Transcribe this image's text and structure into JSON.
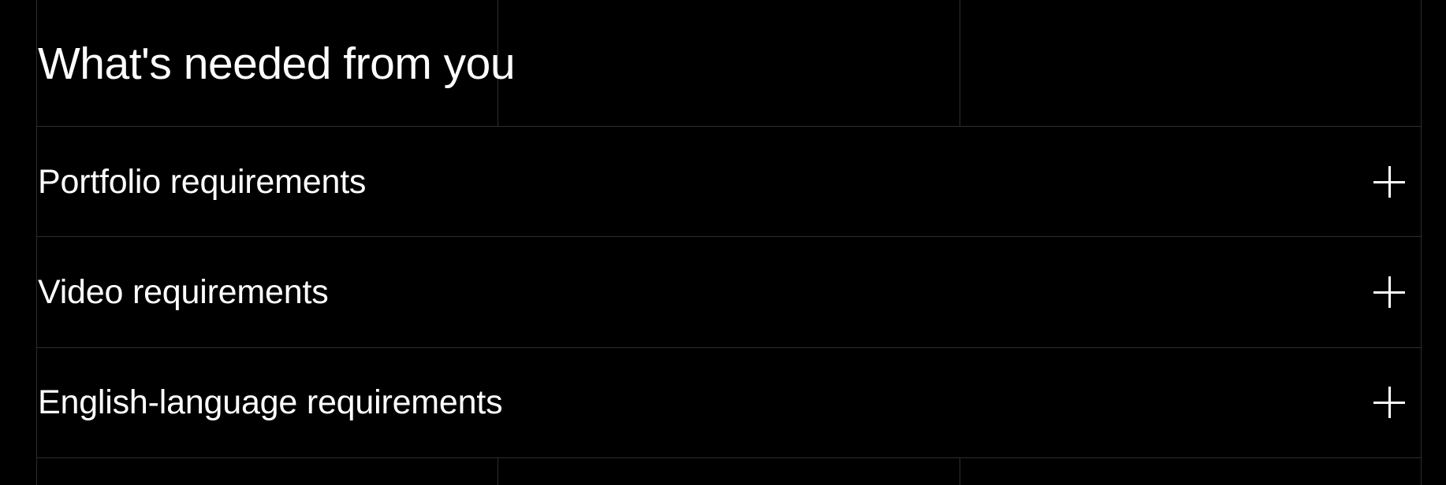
{
  "section": {
    "title": "What's needed from you"
  },
  "accordion": {
    "items": [
      {
        "label": "Portfolio requirements",
        "expanded": false,
        "icon": "plus-icon"
      },
      {
        "label": "Video requirements",
        "expanded": false,
        "icon": "plus-icon"
      },
      {
        "label": "English-language requirements",
        "expanded": false,
        "icon": "plus-icon"
      }
    ]
  },
  "colors": {
    "background": "#000000",
    "text": "#ffffff",
    "divider": "#2e2e2e"
  }
}
